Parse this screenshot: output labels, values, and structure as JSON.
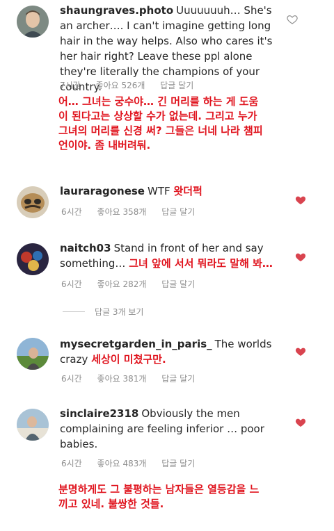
{
  "comments": [
    {
      "username": "shaungraves.photo",
      "text": "Uuuuuuuh… She's an archer…. I can't imagine getting long hair in the way helps. Also who cares it's her hair right? Leave these ppl alone they're literally the champions of your country.",
      "time": "7시간",
      "likes": "좋아요 526개",
      "reply": "답글 달기",
      "translation": "어… 그녀는 궁수야… 긴 머리를 하는 게 도움이 된다고는 상상할 수가 없는데. 그리고 누가 그녀의 머리를 신경 써? 그들은 너네 나라 챔피언이야. 좀 내버려둬.",
      "liked": false
    },
    {
      "username": "lauraragonese",
      "text": "WTF",
      "translation": "왓더퍽",
      "time": "6시간",
      "likes": "좋아요 358개",
      "reply": "답글 달기",
      "liked": true
    },
    {
      "username": "naitch03",
      "text": "Stand in front of her and say something…",
      "translation": "그녀 앞에 서서 뭐라도 말해 봐…",
      "time": "6시간",
      "likes": "좋아요 282개",
      "reply": "답글 달기",
      "liked": true
    },
    {
      "username": "mysecretgarden_in_paris_",
      "text": "The worlds crazy",
      "translation": "세상이 미쳤구만.",
      "time": "6시간",
      "likes": "좋아요 381개",
      "reply": "답글 달기",
      "liked": true
    },
    {
      "username": "sinclaire2318",
      "text": "Obviously the men complaining are feeling inferior … poor babies.",
      "translation": "분명하게도 그 불평하는 남자들은 열등감을 느끼고 있네. 불쌍한 것들.",
      "time": "6시간",
      "likes": "좋아요 483개",
      "reply": "답글 달기",
      "liked": true
    }
  ],
  "view_replies": "답글 3개 보기",
  "colors": {
    "heart_liked": "#ed4956",
    "translation": "#e0141e",
    "meta": "#8e8e8e"
  }
}
